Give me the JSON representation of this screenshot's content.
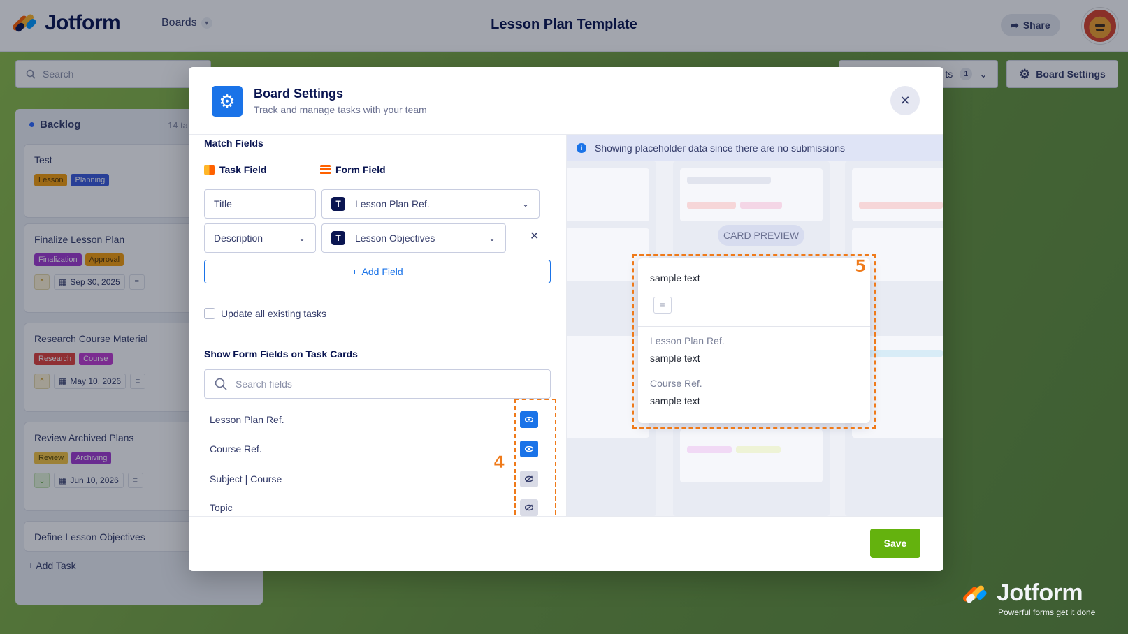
{
  "app": {
    "brand": "Jotform",
    "boards_menu": "Boards",
    "page_title": "Lesson Plan Template",
    "share_label": "Share"
  },
  "toolbar": {
    "search_placeholder": "Search",
    "filter_label": "ts",
    "filter_count": "1",
    "board_settings_label": "Board Settings"
  },
  "board": {
    "column_name": "Backlog",
    "column_count": "14 ta",
    "cards": [
      {
        "title": "Test",
        "tags": [
          {
            "label": "Lesson",
            "color": "#f59e0b"
          },
          {
            "label": "Planning",
            "color": "#3b5bdb"
          }
        ]
      },
      {
        "title": "Finalize Lesson Plan",
        "tags": [
          {
            "label": "Finalization",
            "color": "#a33bd1"
          },
          {
            "label": "Approval",
            "color": "#f59e0b"
          }
        ],
        "date": "Sep 30, 2025",
        "priority": "high"
      },
      {
        "title": "Research Course Material",
        "tags": [
          {
            "label": "Research",
            "color": "#e0423a"
          },
          {
            "label": "Course",
            "color": "#c13bd1"
          }
        ],
        "date": "May 10, 2026",
        "priority": "high"
      },
      {
        "title": "Review Archived Plans",
        "tags": [
          {
            "label": "Review",
            "color": "#f5c542"
          },
          {
            "label": "Archiving",
            "color": "#a33bd1"
          }
        ],
        "date": "Jun 10, 2026",
        "priority": "low"
      },
      {
        "title": "Define Lesson Objectives"
      }
    ],
    "add_task_label": "+ Add Task"
  },
  "modal": {
    "title": "Board Settings",
    "subtitle": "Track and manage tasks with your team",
    "match_fields_title": "Match Fields",
    "task_field_header": "Task Field",
    "form_field_header": "Form Field",
    "mappings": [
      {
        "task_field": "Title",
        "form_field": "Lesson Plan Ref."
      },
      {
        "task_field": "Description",
        "form_field": "Lesson Objectives"
      }
    ],
    "add_field_label": "Add Field",
    "update_existing_label": "Update all existing tasks",
    "show_fields_title": "Show Form Fields on Task Cards",
    "search_fields_placeholder": "Search fields",
    "visible_fields": [
      {
        "label": "Lesson Plan Ref.",
        "visible": true
      },
      {
        "label": "Course Ref.",
        "visible": true
      },
      {
        "label": "Subject | Course",
        "visible": false
      },
      {
        "label": "Topic",
        "visible": false
      }
    ],
    "annotation_left": "4",
    "annotation_right": "5",
    "save_label": "Save"
  },
  "preview": {
    "info_text": "Showing placeholder data since there are no submissions",
    "pill_label": "CARD PREVIEW",
    "card_title": "sample text",
    "fields": [
      {
        "label": "Lesson Plan Ref.",
        "value": "sample text"
      },
      {
        "label": "Course Ref.",
        "value": "sample text"
      }
    ]
  },
  "watermark": {
    "brand": "Jotform",
    "tagline": "Powerful forms get it done"
  },
  "colors": {
    "accent_blue": "#1a73e8",
    "save_green": "#64b20e",
    "annotation_orange": "#ef7a1a",
    "brand_navy": "#0a1551"
  }
}
